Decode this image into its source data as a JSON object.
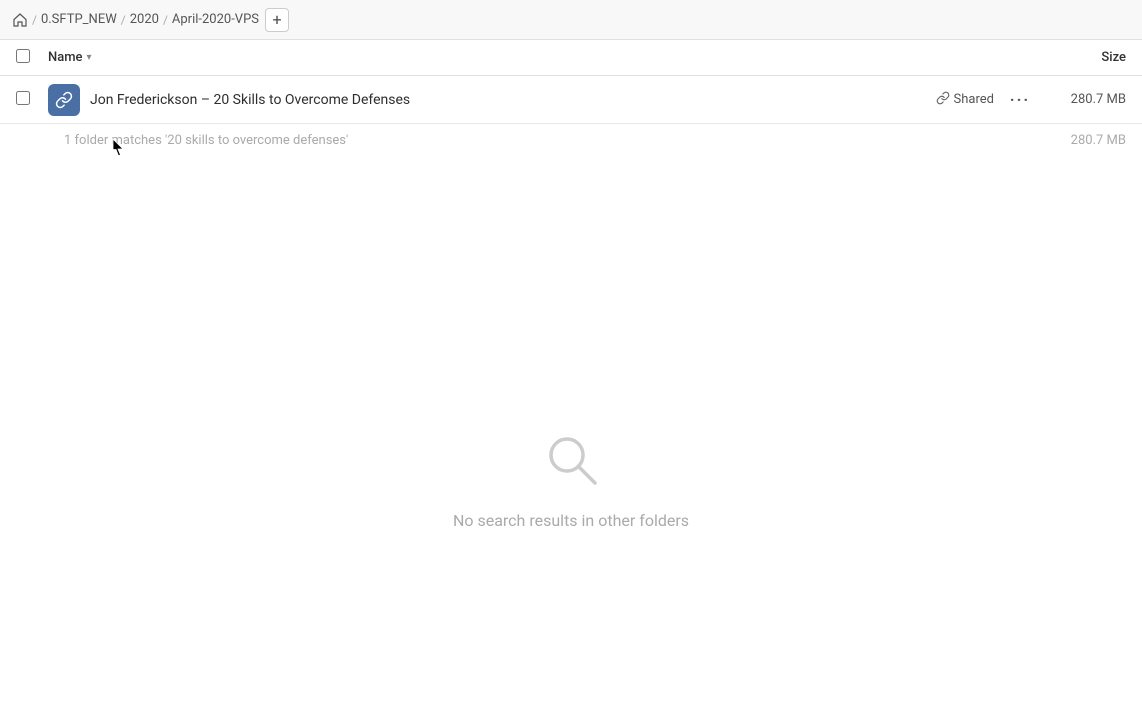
{
  "breadcrumb": {
    "home_icon": "home",
    "items": [
      {
        "label": "0.SFTP_NEW",
        "id": "sftp-new"
      },
      {
        "label": "2020",
        "id": "2020"
      },
      {
        "label": "April-2020-VPS",
        "id": "april-2020-vps"
      }
    ],
    "add_button_label": "+"
  },
  "column_headers": {
    "name_label": "Name",
    "size_label": "Size"
  },
  "file_row": {
    "name": "Jon Frederickson – 20 Skills to Overcome Defenses",
    "shared_label": "Shared",
    "size": "280.7 MB",
    "more_icon": "•••"
  },
  "results_summary": {
    "text": "1 folder matches '20 skills to overcome defenses'",
    "size": "280.7 MB"
  },
  "no_results": {
    "text": "No search results in other folders"
  }
}
